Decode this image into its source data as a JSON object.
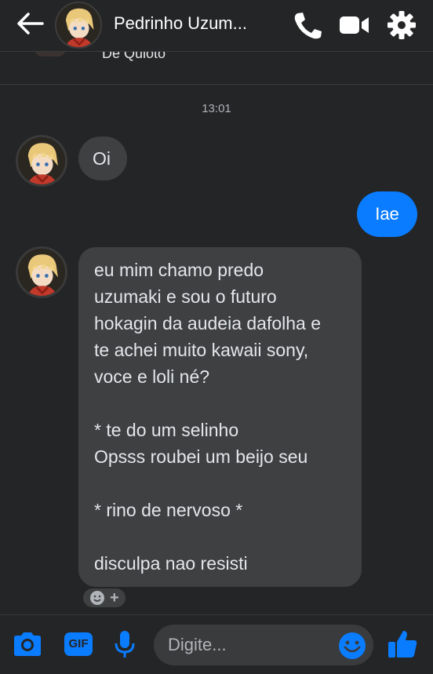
{
  "header": {
    "back_icon": "arrow-left-icon",
    "title": "Pedrinho Uzum...",
    "call_icon": "phone-icon",
    "video_icon": "video-camera-icon",
    "settings_icon": "gear-icon"
  },
  "clipped_note": {
    "text": "De Quioto"
  },
  "timestamp": "13:01",
  "messages": [
    {
      "direction": "incoming",
      "text": "Oi"
    },
    {
      "direction": "outgoing",
      "text": "Iae"
    },
    {
      "direction": "incoming",
      "text": "eu mim chamo predo\nuzumaki e sou o futuro\nhokagin da audeia dafolha e\nte achei muito kawaii sony,\nvoce e loli né?\n\n* te do um selinho\nOpsss roubei um beijo seu\n\n* rino de nervoso *\n\ndisculpa nao resisti"
    }
  ],
  "reaction": {
    "icon": "add-reaction-icon",
    "plus": "+"
  },
  "composer": {
    "camera_icon": "camera-icon",
    "gif_label": "GIF",
    "mic_icon": "microphone-icon",
    "placeholder": "Digite...",
    "emoji_icon": "smiley-icon",
    "like_icon": "thumbs-up-icon"
  },
  "colors": {
    "background": "#242526",
    "incoming_bubble": "#3e4042",
    "outgoing_bubble": "#0a7cff",
    "accent": "#0a7cff"
  }
}
